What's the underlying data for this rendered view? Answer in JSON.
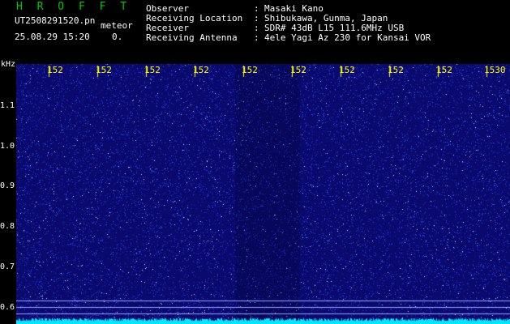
{
  "header": {
    "app_title": "H R O F F T",
    "file_name": "UT2508291520.pn",
    "meteor_label": "meteor",
    "timestamp": "25.08.29 15:20",
    "count": "0.",
    "info": [
      {
        "label": "Observer",
        "value": "Masaki Kano"
      },
      {
        "label": "Receiving Location",
        "value": "Shibukawa, Gunma, Japan"
      },
      {
        "label": "Receiver",
        "value": "SDR# 43dB L15 111.6MHz USB"
      },
      {
        "label": "Receiving Antenna",
        "value": "4ele Yagi Az 230 for Kansai VOR"
      }
    ],
    "separator": ":"
  },
  "waterfall": {
    "unit_label": "kHz",
    "freq_labels": [
      "1.1",
      "1.0",
      "0.9",
      "0.8",
      "0.7",
      "0.6"
    ],
    "time_labels": [
      "152",
      "152",
      "152",
      "152",
      "152",
      "152",
      "152",
      "152",
      "152",
      "1530"
    ],
    "colors": {
      "background": "#0a0a6e",
      "noise": "#4a5cff",
      "signal": "#00e6ff",
      "marker_line": "#9aa0ff",
      "tick": "#ffff00"
    }
  }
}
